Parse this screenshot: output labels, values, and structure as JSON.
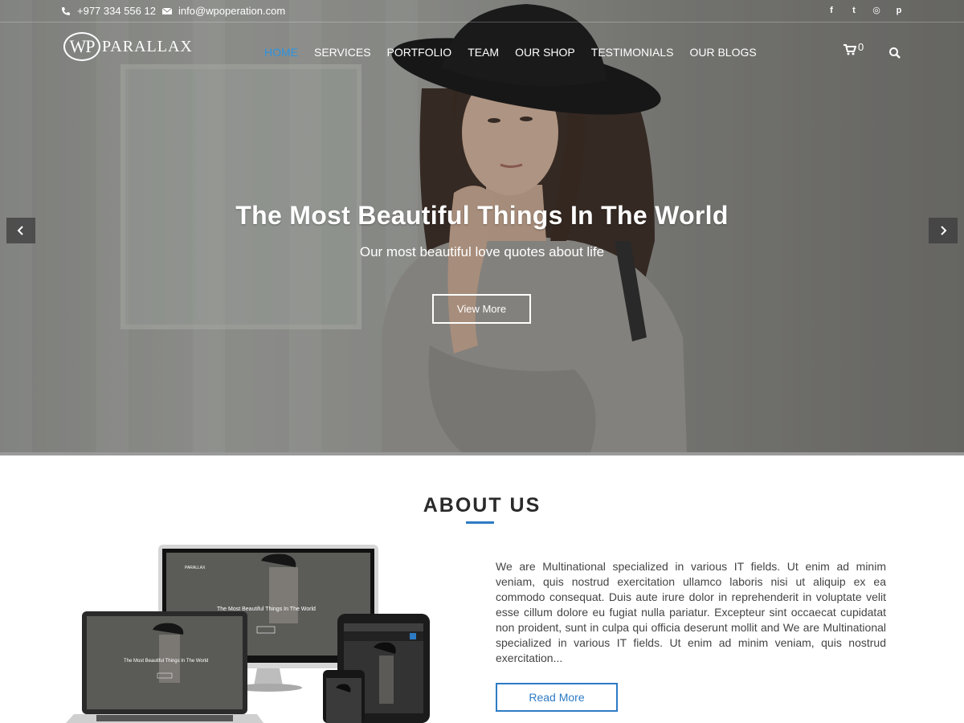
{
  "topbar": {
    "phone": "+977 334 556 12",
    "email": "info@wpoperation.com",
    "socials": [
      {
        "icon": "facebook-icon",
        "glyph": "f"
      },
      {
        "icon": "twitter-icon",
        "glyph": "t"
      },
      {
        "icon": "instagram-icon",
        "glyph": "◎"
      },
      {
        "icon": "pinterest-icon",
        "glyph": "p"
      }
    ]
  },
  "logo": {
    "mark": "WP",
    "text": "PARALLAX"
  },
  "nav": {
    "items": [
      "HOME",
      "SERVICES",
      "PORTFOLIO",
      "TEAM",
      "OUR SHOP",
      "TESTIMONIALS",
      "OUR BLOGS"
    ],
    "active": "HOME"
  },
  "cart": {
    "count": "0"
  },
  "hero": {
    "title": "The Most Beautiful Things In The World",
    "subtitle": "Our most beautiful love quotes about life",
    "button": "View More"
  },
  "about": {
    "title": "ABOUT US",
    "text": "We are Multinational specialized in various IT fields. Ut enim ad minim veniam, quis nostrud exercitation ullamco laboris nisi ut aliquip ex ea commodo consequat. Duis aute irure dolor in reprehenderit in voluptate velit esse cillum dolore eu fugiat nulla pariatur. Excepteur sint occaecat cupidatat non proident, sunt in culpa qui officia deserunt mollit and We are Multinational specialized in various IT fields. Ut enim ad minim veniam, quis nostrud exercitation...",
    "button": "Read More"
  },
  "device_mockup": {
    "screen_title": "The Most Beautiful Things In The World",
    "screen_logo": "PARALLAX"
  },
  "colors": {
    "accent": "#2d7bc5",
    "nav_active": "#2d93e0"
  }
}
